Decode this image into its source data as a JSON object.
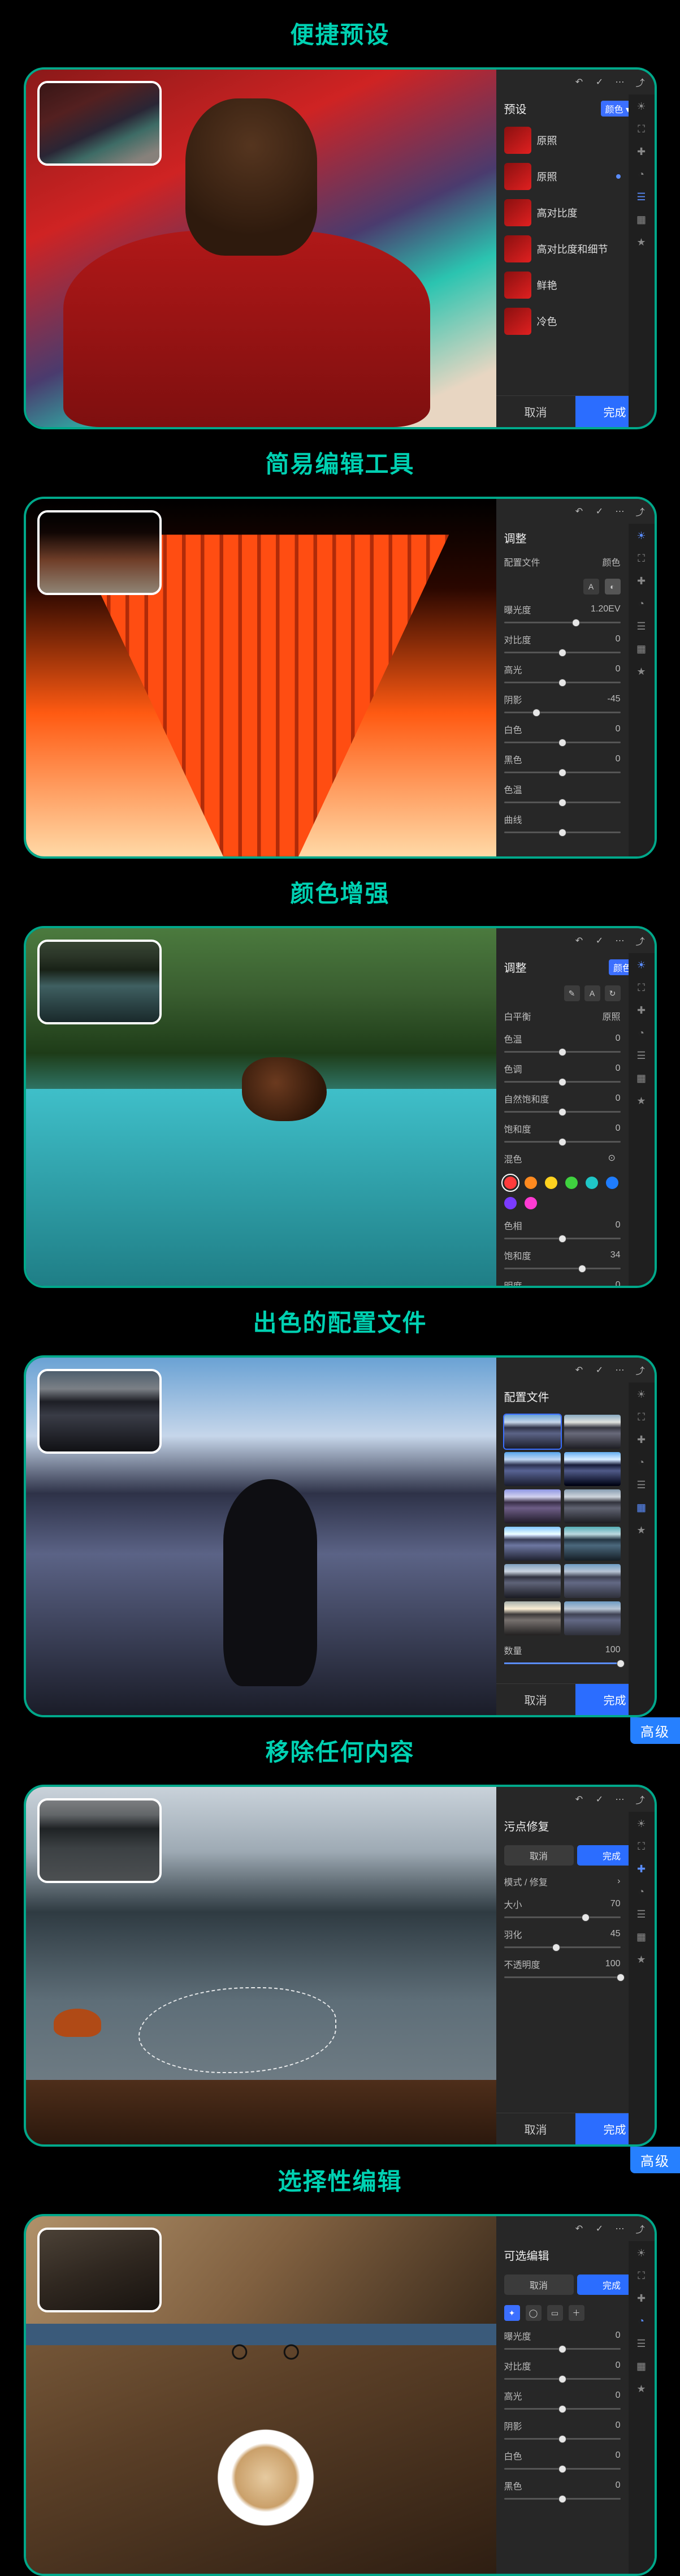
{
  "sections": [
    {
      "title": "便捷预设",
      "badge": null
    },
    {
      "title": "简易编辑工具",
      "badge": null
    },
    {
      "title": "颜色增强",
      "badge": null
    },
    {
      "title": "出色的配置文件",
      "badge": null
    },
    {
      "title": "移除任何内容",
      "badge": "高级"
    },
    {
      "title": "选择性编辑",
      "badge": "高级"
    }
  ],
  "presets": {
    "panel_title": "预设",
    "chip": "颜色 ▾",
    "collapse": "≡",
    "items": [
      {
        "label": "原照",
        "dot": false
      },
      {
        "label": "原照",
        "dot": true
      },
      {
        "label": "高对比度",
        "dot": false
      },
      {
        "label": "高对比度和细节",
        "dot": false
      },
      {
        "label": "鲜艳",
        "dot": false
      },
      {
        "label": "冷色",
        "dot": false
      }
    ],
    "footer": {
      "cancel": "取消",
      "done": "完成"
    }
  },
  "edit_tools": {
    "panel_title": "调整",
    "profile_label": "配置文件",
    "profile_value": "颜色",
    "sliders": [
      {
        "name": "曝光度",
        "value": "1.20EV",
        "pos": 62
      },
      {
        "name": "对比度",
        "value": "0",
        "pos": 50
      },
      {
        "name": "高光",
        "value": "0",
        "pos": 50
      },
      {
        "name": "阴影",
        "value": "-45",
        "pos": 28
      },
      {
        "name": "白色",
        "value": "0",
        "pos": 50
      },
      {
        "name": "黑色",
        "value": "0",
        "pos": 50
      },
      {
        "name": "色温",
        "value": "",
        "pos": 50
      },
      {
        "name": "曲线",
        "value": "",
        "pos": 50
      }
    ]
  },
  "color": {
    "panel_title": "调整",
    "mode_chip": "颜色",
    "rows": [
      {
        "name": "白平衡",
        "value": "原照",
        "type": "label"
      },
      {
        "name": "色温",
        "value": "0",
        "pos": 50
      },
      {
        "name": "色调",
        "value": "0",
        "pos": 50
      },
      {
        "name": "自然饱和度",
        "value": "0",
        "pos": 50
      },
      {
        "name": "饱和度",
        "value": "0",
        "pos": 50
      }
    ],
    "mix_label": "混色",
    "swatches": [
      "#ff3b3b",
      "#ff8a1f",
      "#ffd21f",
      "#3fd23f",
      "#1fc6c6",
      "#1f7dff",
      "#7a3bff",
      "#ff3bd2"
    ],
    "swatch_sel": 0,
    "detail": [
      {
        "name": "色相",
        "value": "0",
        "pos": 50
      },
      {
        "name": "饱和度",
        "value": "34",
        "pos": 67
      },
      {
        "name": "明度",
        "value": "0",
        "pos": 50
      }
    ]
  },
  "profiles": {
    "panel_title": "配置文件",
    "amount_label": "数量",
    "amount_value": "100",
    "grid_count": 12,
    "selected": 0,
    "footer": {
      "cancel": "取消",
      "done": "完成"
    }
  },
  "heal": {
    "panel_title": "污点修复",
    "seg": [
      "取消",
      "完成"
    ],
    "seg_on": 1,
    "mode_label": "模式 / 修复",
    "sliders": [
      {
        "name": "大小",
        "value": "70",
        "pos": 70
      },
      {
        "name": "羽化",
        "value": "45",
        "pos": 45
      },
      {
        "name": "不透明度",
        "value": "100",
        "pos": 100
      }
    ]
  },
  "selective": {
    "panel_title": "可选编辑",
    "seg": [
      "取消",
      "完成"
    ],
    "seg_on": 1,
    "sliders": [
      {
        "name": "曝光度",
        "value": "0",
        "pos": 50
      },
      {
        "name": "对比度",
        "value": "0",
        "pos": 50
      },
      {
        "name": "高光",
        "value": "0",
        "pos": 50
      },
      {
        "name": "阴影",
        "value": "0",
        "pos": 50
      },
      {
        "name": "白色",
        "value": "0",
        "pos": 50
      },
      {
        "name": "黑色",
        "value": "0",
        "pos": 50
      }
    ]
  },
  "rail_icons": [
    "tune",
    "crop",
    "heal",
    "mask",
    "presets",
    "profiles",
    "star"
  ],
  "topbar_icons": [
    "undo",
    "check",
    "more",
    "share"
  ]
}
